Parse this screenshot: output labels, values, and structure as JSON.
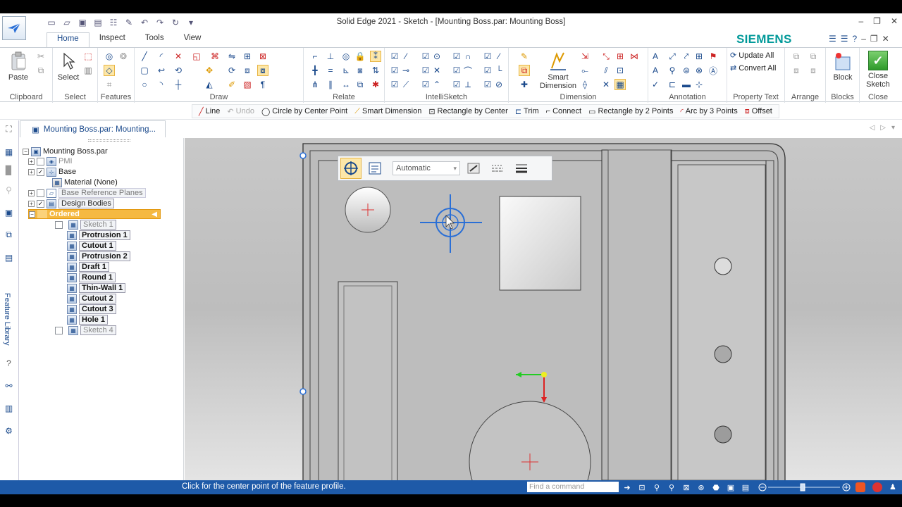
{
  "window": {
    "title": "Solid Edge 2021 - Sketch - [Mounting Boss.par: Mounting Boss]",
    "brand": "SIEMENS",
    "controls": [
      "–",
      "❐",
      "✕"
    ]
  },
  "tabs": [
    {
      "label": "Home",
      "active": true
    },
    {
      "label": "Inspect"
    },
    {
      "label": "Tools"
    },
    {
      "label": "View"
    }
  ],
  "ribbon": {
    "clipboard": {
      "group": "Clipboard",
      "paste": "Paste"
    },
    "select": {
      "group": "Select",
      "select": "Select"
    },
    "features": {
      "group": "Features"
    },
    "draw": {
      "group": "Draw"
    },
    "relate": {
      "group": "Relate"
    },
    "intellisketch": {
      "group": "IntelliSketch"
    },
    "dimension": {
      "group": "Dimension",
      "smart_line1": "Smart",
      "smart_line2": "Dimension"
    },
    "annotation": {
      "group": "Annotation"
    },
    "property_text": {
      "group": "Property Text",
      "update_all": "Update All",
      "convert_all": "Convert All"
    },
    "arrange": {
      "group": "Arrange"
    },
    "blocks": {
      "group": "Blocks",
      "block": "Block"
    },
    "close": {
      "group": "Close",
      "line1": "Close",
      "line2": "Sketch"
    }
  },
  "command_bar": [
    {
      "label": "Line",
      "icon": "line-icon"
    },
    {
      "label": "Undo",
      "icon": "undo-icon",
      "disabled": true
    },
    {
      "label": "Circle by Center Point",
      "icon": "circle-icon"
    },
    {
      "label": "Smart Dimension",
      "icon": "smart-dimension-icon"
    },
    {
      "label": "Rectangle by Center",
      "icon": "rectangle-center-icon"
    },
    {
      "label": "Trim",
      "icon": "trim-icon"
    },
    {
      "label": "Connect",
      "icon": "connect-icon"
    },
    {
      "label": "Rectangle by 2 Points",
      "icon": "rectangle-icon"
    },
    {
      "label": "Arc by 3 Points",
      "icon": "arc-icon"
    },
    {
      "label": "Offset",
      "icon": "offset-icon"
    }
  ],
  "left_strip": {
    "feature_library": "Feature Library"
  },
  "doc_tab": {
    "label": "Mounting Boss.par: Mounting..."
  },
  "pathfinder": {
    "root": "Mounting Boss.par",
    "pmi": "PMI",
    "base": "Base",
    "material": "Material (None)",
    "base_ref_planes": "Base Reference Planes",
    "design_bodies": "Design Bodies",
    "ordered": "Ordered",
    "features": [
      {
        "label": "Sketch 1",
        "style": "gray",
        "checkbox": true
      },
      {
        "label": "Protrusion 1",
        "style": "bold"
      },
      {
        "label": "Cutout 1",
        "style": "bold"
      },
      {
        "label": "Protrusion 2",
        "style": "bold"
      },
      {
        "label": "Draft 1",
        "style": "bold"
      },
      {
        "label": "Round 1",
        "style": "bold"
      },
      {
        "label": "Thin-Wall 1",
        "style": "bold"
      },
      {
        "label": "Cutout 2",
        "style": "bold"
      },
      {
        "label": "Cutout 3",
        "style": "bold"
      },
      {
        "label": "Hole 1",
        "style": "bold"
      },
      {
        "label": "Sketch 4",
        "style": "gray",
        "checkbox": true
      }
    ]
  },
  "floating_toolbar": {
    "select_value": "Automatic"
  },
  "statusbar": {
    "message": "Click for the center point of the feature profile.",
    "find_placeholder": "Find a command"
  },
  "colors": {
    "accent": "#1e5aa8",
    "brand": "#009999",
    "ordered_highlight": "#f5b942",
    "sketch_blue": "#2a6fd6"
  }
}
